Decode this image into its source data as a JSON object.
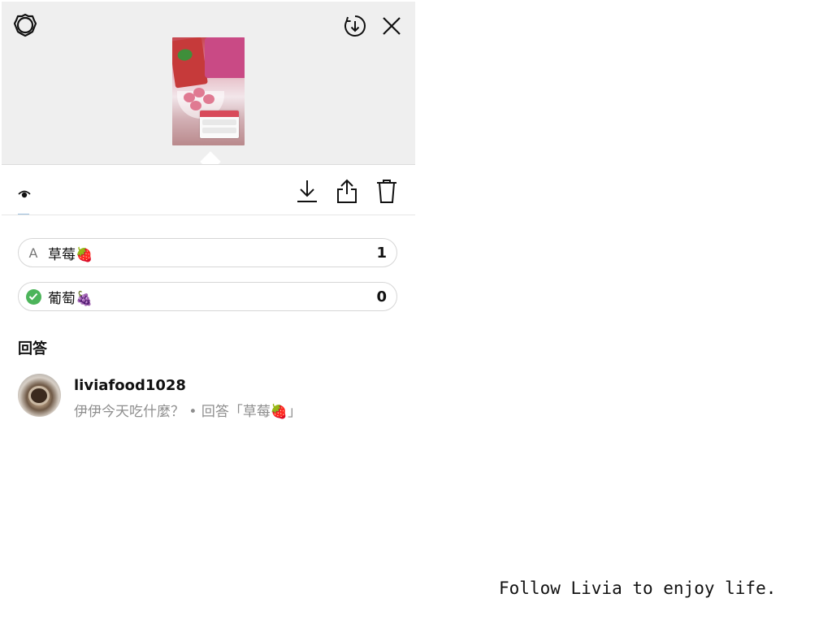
{
  "header": {
    "settings_icon": "gear-icon",
    "save_icon": "download-circle-icon",
    "close_icon": "close-icon"
  },
  "story": {
    "thumbnail": "story-thumbnail"
  },
  "toolbar": {
    "viewers_icon": "eye-icon",
    "download_icon": "download-icon",
    "share_icon": "share-icon",
    "delete_icon": "trash-icon"
  },
  "poll": {
    "options": [
      {
        "marker": "A",
        "label": "草莓🍓",
        "count": "1"
      },
      {
        "marker": "check",
        "label": "葡萄🍇",
        "count": "0"
      }
    ],
    "marker_color": "#4cb45a"
  },
  "responses": {
    "title": "回答",
    "items": [
      {
        "username": "liviafood1028",
        "meta": "伊伊今天吃什麼？ • 回答「草莓🍓」"
      }
    ]
  },
  "footer": {
    "caption": "Follow Livia to enjoy life."
  }
}
